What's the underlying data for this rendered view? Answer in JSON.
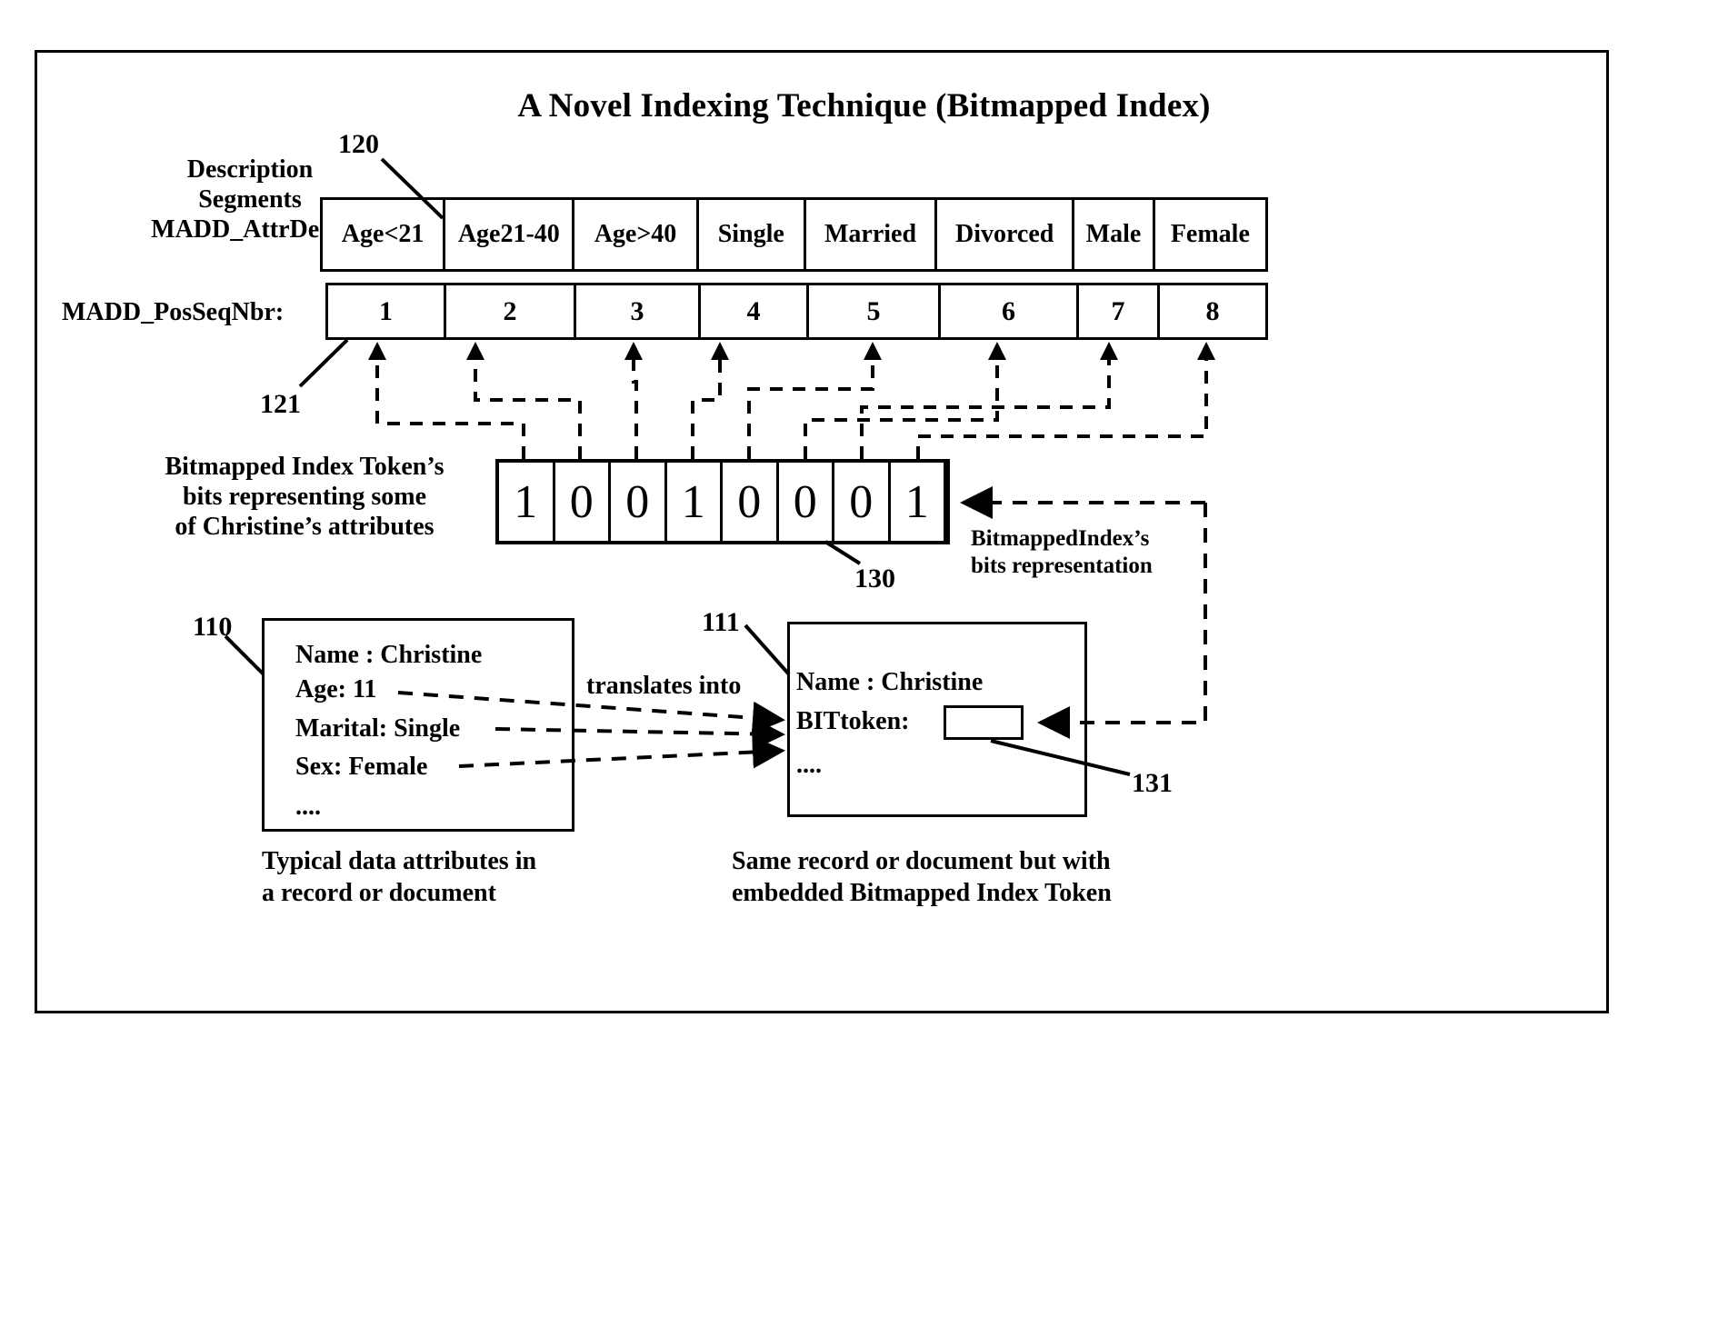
{
  "figure": {
    "title": "A Novel Indexing Technique (Bitmapped Index)"
  },
  "labels": {
    "description_segments": "Description\nSegments\nMADD_AttrDesc:",
    "pos_seq_nbr": "MADD_PosSeqNbr:",
    "bitmapped_token_caption": "Bitmapped Index Token’s\nbits representing some\nof Christine’s attributes",
    "bitmapped_index_bits_rep": "BitmappedIndex’s\nbits representation",
    "translates_into": "translates into",
    "caption_left": "Typical data attributes in\na record or document",
    "caption_right": "Same record or document but with\nembedded Bitmapped Index Token"
  },
  "attr_desc_row": {
    "cells": [
      "Age<21",
      "Age21-40",
      "Age>40",
      "Single",
      "Married",
      "Divorced",
      "Male",
      "Female"
    ]
  },
  "pos_seq_row": {
    "cells": [
      "1",
      "2",
      "3",
      "4",
      "5",
      "6",
      "7",
      "8"
    ]
  },
  "bit_token": {
    "bits": [
      "1",
      "0",
      "0",
      "1",
      "0",
      "0",
      "0",
      "1"
    ]
  },
  "record_left": {
    "lines": [
      "Name : Christine",
      "Age: 11",
      "Marital: Single",
      "Sex: Female",
      "...."
    ]
  },
  "record_right": {
    "lines": [
      "Name : Christine",
      "BITtoken:",
      "...."
    ]
  },
  "reference_numerals": {
    "n120": "120",
    "n121": "121",
    "n130": "130",
    "n110": "110",
    "n111": "111",
    "n131": "131"
  },
  "colors": {
    "ink": "#000000",
    "paper": "#ffffff"
  }
}
